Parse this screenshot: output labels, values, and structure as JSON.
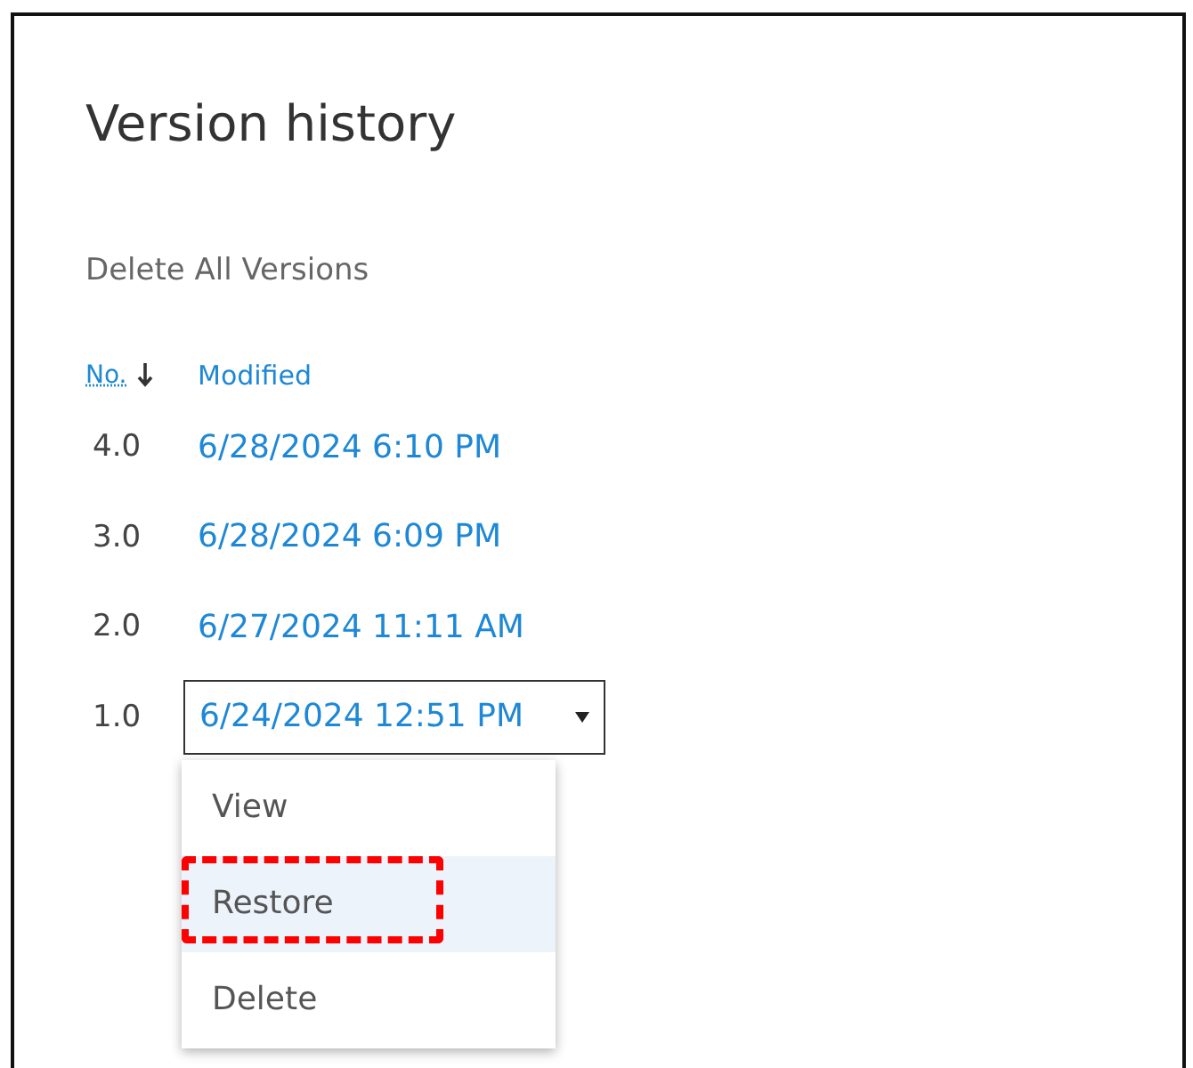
{
  "title": "Version history",
  "delete_all": "Delete All Versions",
  "columns": [
    {
      "label": "No.",
      "sorted_descending": true
    },
    {
      "label": "Modified"
    }
  ],
  "rows": [
    {
      "no": "4.0",
      "modified": "6/28/2024 6:10 PM",
      "menu_open": false
    },
    {
      "no": "3.0",
      "modified": "6/28/2024 6:09 PM",
      "menu_open": false
    },
    {
      "no": "2.0",
      "modified": "6/27/2024 11:11 AM",
      "menu_open": false
    },
    {
      "no": "1.0",
      "modified": "6/24/2024 12:51 PM",
      "menu_open": true
    }
  ],
  "menu": [
    {
      "label": "View",
      "selected": false,
      "annotated": false
    },
    {
      "label": "Restore",
      "selected": true,
      "annotated": true
    },
    {
      "label": "Delete",
      "selected": false,
      "annotated": false
    }
  ]
}
